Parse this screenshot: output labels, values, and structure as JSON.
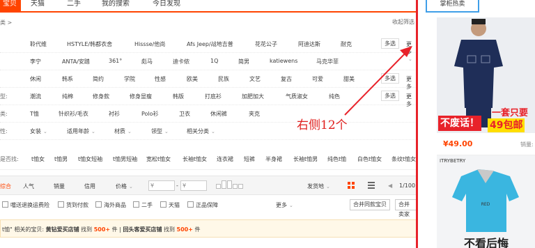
{
  "topnav": {
    "tabs": [
      "宝贝",
      "天猫",
      "二手",
      "我的搜索",
      "今日发现"
    ]
  },
  "breadcrumb": "类 >",
  "collapse": "收起筛选",
  "rows": [
    {
      "label": "",
      "values": [
        "聆代维",
        "HSTYLE/韩都衣舍",
        "Hissse/他尚",
        "Afs Jeep/战地吉普",
        "花花公子",
        "阿迪达斯",
        "耐克"
      ],
      "multi": "多选",
      "more": "更多"
    },
    {
      "label": "",
      "values": [
        "李宁",
        "ANTA/安踏",
        "361°",
        "彪马",
        "迪卡侬",
        "1Q",
        "简男",
        "katiewens",
        "马克华菲"
      ]
    },
    {
      "label": "",
      "values": [
        "休闲",
        "韩系",
        "简约",
        "学院",
        "性感",
        "欧美",
        "民族",
        "文艺",
        "复古",
        "可爱",
        "甜美"
      ],
      "multi": "多选",
      "more": "更多"
    },
    {
      "label": "型:",
      "values": [
        "潮流",
        "纯棉",
        "修身款",
        "修身显瘦",
        "韩版",
        "打底衫",
        "加肥加大",
        "气质淑女",
        "纯色"
      ],
      "multi": "多选",
      "more": "更多"
    },
    {
      "label": "类:",
      "values": [
        "T恤",
        "针织衫/毛衣",
        "衬衫",
        "Polo衫",
        "卫衣",
        "休闲裤",
        "夹克"
      ]
    },
    {
      "label": "性:",
      "values": [
        "女装",
        "适用年龄",
        "材质",
        "领型",
        "相关分类"
      ]
    }
  ],
  "related": {
    "label": "是否找:",
    "values": [
      "t恤女",
      "t恤男",
      "t恤女短袖",
      "t恤男短袖",
      "宽松t恤女",
      "长袖t恤女",
      "连衣裙",
      "短裤",
      "半身裙",
      "长袖t恤男",
      "纯色t恤",
      "白色t恤女",
      "条纹t恤女"
    ]
  },
  "sortbar": {
    "items": [
      "综合",
      "人气",
      "销量",
      "信用",
      "价格"
    ],
    "price_placeholder": "¥",
    "ship_from": "发货地",
    "page": "1/100"
  },
  "filters": {
    "checks": [
      "噹送退换运费险",
      "货到付款",
      "海外商品",
      "二手",
      "天猫",
      "正品保障"
    ],
    "more": "更多",
    "btn_merge": "合并同款宝贝",
    "btn_seller": "合并卖家"
  },
  "notice": {
    "pre": "t恤\" 相关的宝贝:",
    "shop1": "黄钻爱买店铺",
    "mid1": "找到",
    "count1": "500+",
    "unit1": "件",
    "sep": "|",
    "shop2": "回头客爱买店铺",
    "mid2": "找到",
    "count2": "500+",
    "unit2": "件"
  },
  "annotation": "右侧12个",
  "right": {
    "title": "掌柜热卖",
    "badge1": "不废话！",
    "badge2": "一套只要",
    "badge3": "49包邮",
    "price": "¥49.00",
    "sales": "销量:",
    "brand": "ITRYBETRY",
    "badge4": "不看后悔"
  }
}
